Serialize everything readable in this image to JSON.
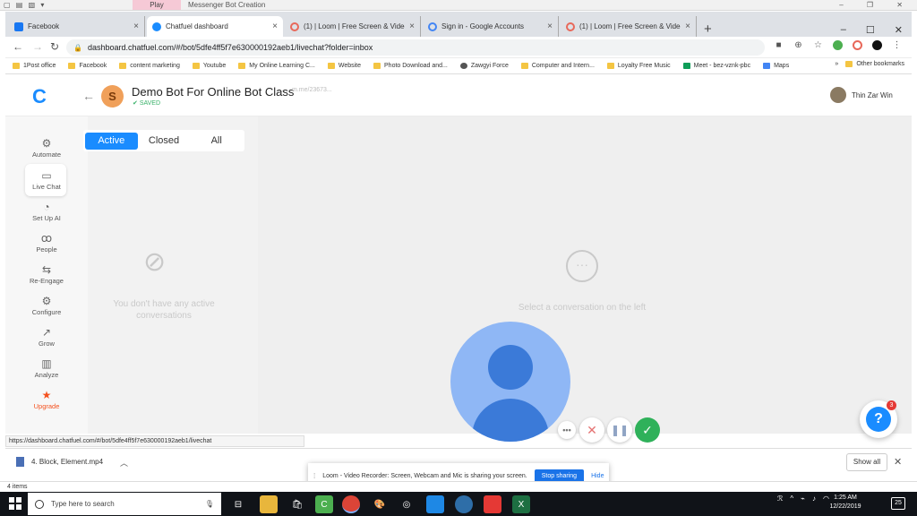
{
  "outer": {
    "play_label": "Play",
    "title": "Messenger Bot Creation"
  },
  "tabs": [
    {
      "label": "Facebook",
      "color": "#1877f2"
    },
    {
      "label": "Chatfuel dashboard",
      "color": "#1a8cff"
    },
    {
      "label": "(1) | Loom | Free Screen & Video R",
      "color": "#e8685a"
    },
    {
      "label": "Sign in - Google Accounts",
      "color": "#4285f4"
    },
    {
      "label": "(1) | Loom | Free Screen & Video R",
      "color": "#e8685a"
    }
  ],
  "address": {
    "url": "dashboard.chatfuel.com/#/bot/5dfe4ff5f7e630000192aeb1/livechat?folder=inbox"
  },
  "bookmarks": [
    "1Post office",
    "Facebook",
    "content marketing",
    "Youtube",
    "My Online Learning C...",
    "Website",
    "Photo Download and...",
    "Zawgyi Force",
    "Computer and Intern...",
    "Loyalty Free Music",
    "Meet - bez-vznk-pbc",
    "Maps"
  ],
  "bookmarks_more": "»",
  "other_bookmarks": "Other bookmarks",
  "header": {
    "logo": "C",
    "bot_initial": "S",
    "bot_name": "Demo Bot For Online Bot Class",
    "saved": "SAVED",
    "link": "m.me/23673...",
    "user_name": "Thin Zar Win"
  },
  "sidebar": [
    {
      "label": "Automate",
      "icon": "⚙"
    },
    {
      "label": "Live Chat",
      "icon": "💬"
    },
    {
      "label": "Set Up AI",
      "icon": "☺"
    },
    {
      "label": "People",
      "icon": "👥"
    },
    {
      "label": "Re-Engage",
      "icon": "⇆"
    },
    {
      "label": "Configure",
      "icon": "⚙"
    },
    {
      "label": "Grow",
      "icon": "↗"
    },
    {
      "label": "Analyze",
      "icon": "▥"
    },
    {
      "label": "Upgrade",
      "icon": "★"
    }
  ],
  "filter": {
    "active": "Active",
    "closed": "Closed",
    "all": "All"
  },
  "empty_list": "You don't have any active conversations",
  "empty_main": "Select a conversation on the left",
  "help": {
    "label": "?",
    "badge": "3"
  },
  "status_url": "https://dashboard.chatfuel.com/#/bot/5dfe4ff5f7e630000192aeb1/livechat",
  "download": {
    "file": "4. Block, Element.mp4",
    "show_all": "Show all"
  },
  "loom": {
    "message": "Loom - Video Recorder: Screen, Webcam and Mic is sharing your screen.",
    "stop": "Stop sharing",
    "hide": "Hide"
  },
  "items_count": "4 items",
  "taskbar": {
    "search_placeholder": "Type here to search",
    "time": "1:25 AM",
    "date": "12/22/2019",
    "notif": "25"
  },
  "colors": {
    "accent": "#1a8cff",
    "saved": "#3ab26a",
    "upgrade": "#f4511e",
    "done": "#2fb15a"
  }
}
